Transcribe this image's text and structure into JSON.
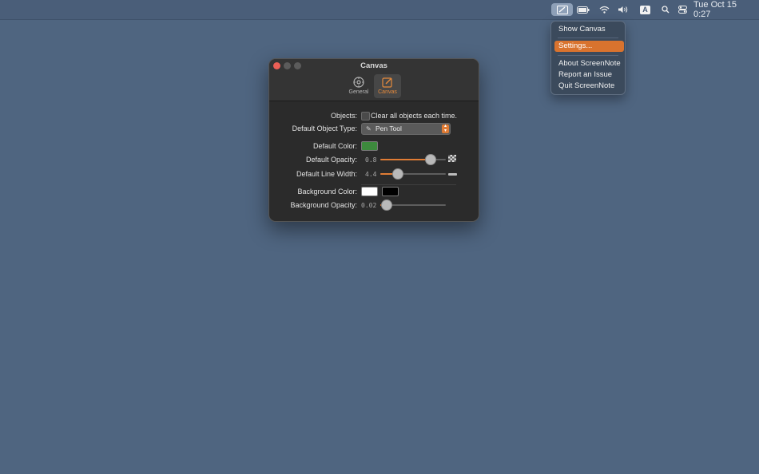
{
  "menubar": {
    "app_icon": "screennote-icon",
    "status_icons": [
      "battery-icon",
      "wifi-icon",
      "volume-icon",
      "keyboard-input-icon",
      "search-icon",
      "control-center-icon"
    ],
    "input_source": "A",
    "clock": "Tue Oct 15  0:27"
  },
  "menu": {
    "items": [
      {
        "label": "Show Canvas"
      },
      {
        "label": "Settings..."
      },
      {
        "label": "About ScreenNote"
      },
      {
        "label": "Report an Issue"
      },
      {
        "label": "Quit ScreenNote"
      }
    ],
    "highlighted": "Settings..."
  },
  "window": {
    "title": "Canvas",
    "tabs": [
      {
        "label": "General",
        "icon": "gear-icon"
      },
      {
        "label": "Canvas",
        "icon": "pencil-square-icon"
      }
    ],
    "active_tab": "Canvas",
    "settings": {
      "objects_label": "Objects:",
      "clear_objects_label": "Clear all objects each time.",
      "clear_objects_checked": false,
      "object_type_label": "Default Object Type:",
      "object_type_value": "Pen Tool",
      "color_label": "Default Color:",
      "color_value": "#3d8a3d",
      "opacity_label": "Default Opacity:",
      "opacity_value": "0.8",
      "line_width_label": "Default Line Width:",
      "line_width_value": "4.4",
      "bg_color_label": "Background Color:",
      "bg_color_values": [
        "#ffffff",
        "#000000"
      ],
      "bg_opacity_label": "Background Opacity:",
      "bg_opacity_value": "0.02"
    }
  },
  "colors": {
    "accent": "#e07c35",
    "desktop": "#4f6580"
  }
}
